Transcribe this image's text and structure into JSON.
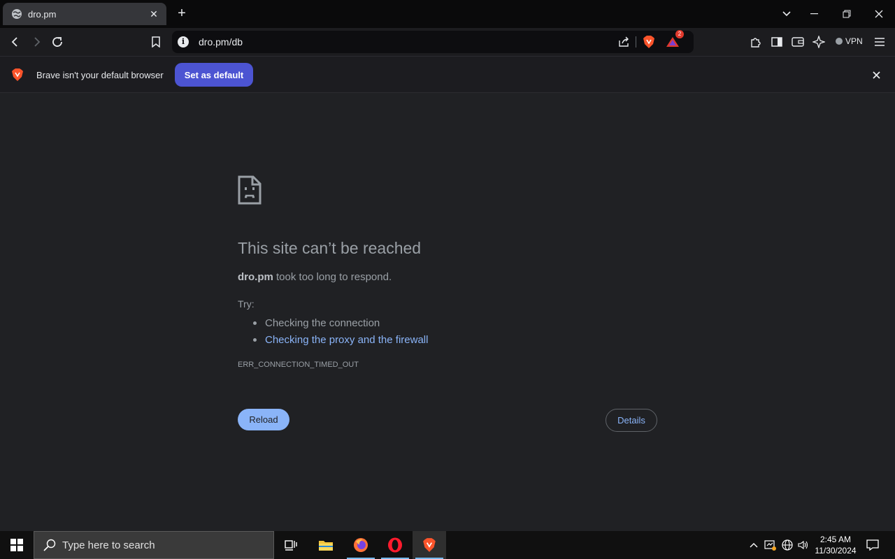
{
  "browser": {
    "tab": {
      "title": "dro.pm",
      "favicon": "globe-icon"
    },
    "url": "dro.pm/db",
    "vpn_label": "VPN",
    "rewards_badge": "2"
  },
  "infobar": {
    "message": "Brave isn't your default browser",
    "button": "Set as default"
  },
  "error_page": {
    "title": "This site can’t be reached",
    "host": "dro.pm",
    "description": " took too long to respond.",
    "try_label": "Try:",
    "suggestions": [
      {
        "text": "Checking the connection",
        "link": false
      },
      {
        "text": "Checking the proxy and the firewall",
        "link": true
      }
    ],
    "error_code": "ERR_CONNECTION_TIMED_OUT",
    "reload_button": "Reload",
    "details_button": "Details"
  },
  "taskbar": {
    "search_placeholder": "Type here to search",
    "time": "2:45 AM",
    "date": "11/30/2024"
  },
  "colors": {
    "accent_blue": "#8ab4f8",
    "brave_orange": "#fb542b",
    "set_default_bg": "#4c54d2"
  }
}
